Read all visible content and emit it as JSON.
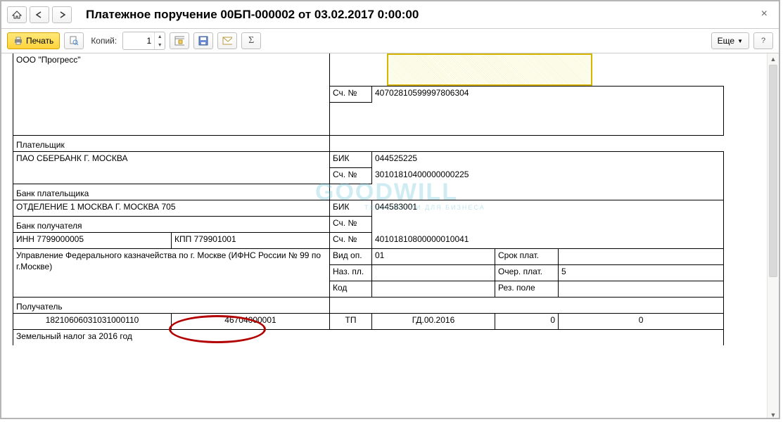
{
  "header": {
    "title": "Платежное поручение 00БП-000002 от 03.02.2017 0:00:00"
  },
  "toolbar": {
    "print": "Печать",
    "copies_label": "Копий:",
    "copies": "1",
    "more": "Еще"
  },
  "doc": {
    "org": "ООО \"Прогресс\"",
    "payer_lbl": "Плательщик",
    "acc_lbl": "Сч. №",
    "payer_acc": "40702810599997806304",
    "payer_bank": "ПАО СБЕРБАНК Г. МОСКВА",
    "payer_bank_lbl": "Банк плательщика",
    "bik_lbl": "БИК",
    "payer_bik": "044525225",
    "payer_bank_acc": "30101810400000000225",
    "ben_bank": "ОТДЕЛЕНИЕ 1 МОСКВА Г. МОСКВА 705",
    "ben_bank_lbl": "Банк получателя",
    "ben_bik": "044583001",
    "inn": "ИНН 7799000005",
    "kpp": "КПП 779901001",
    "ben_acc": "40101810800000010041",
    "ben": "Управление Федерального казначейства по г. Москве (ИФНС России № 99 по г.Москве)",
    "ben_lbl": "Получатель",
    "vidop_lbl": "Вид оп.",
    "vidop": "01",
    "nazpl_lbl": "Наз. пл.",
    "kod_lbl": "Код",
    "srok_lbl": "Срок плат.",
    "ocher_lbl": "Очер. плат.",
    "ocher": "5",
    "rez_lbl": "Рез. поле",
    "kbk": "18210606031031000110",
    "oktmo": "46704000001",
    "basis": "ТП",
    "period": "ГД.00.2016",
    "zero1": "0",
    "zero2": "0",
    "purpose": "Земельный налог за 2016 год"
  },
  "watermark": {
    "main": "GOODWILL",
    "sub": "ТЕХНОЛОГИИ ДЛЯ БИЗНЕСА"
  }
}
